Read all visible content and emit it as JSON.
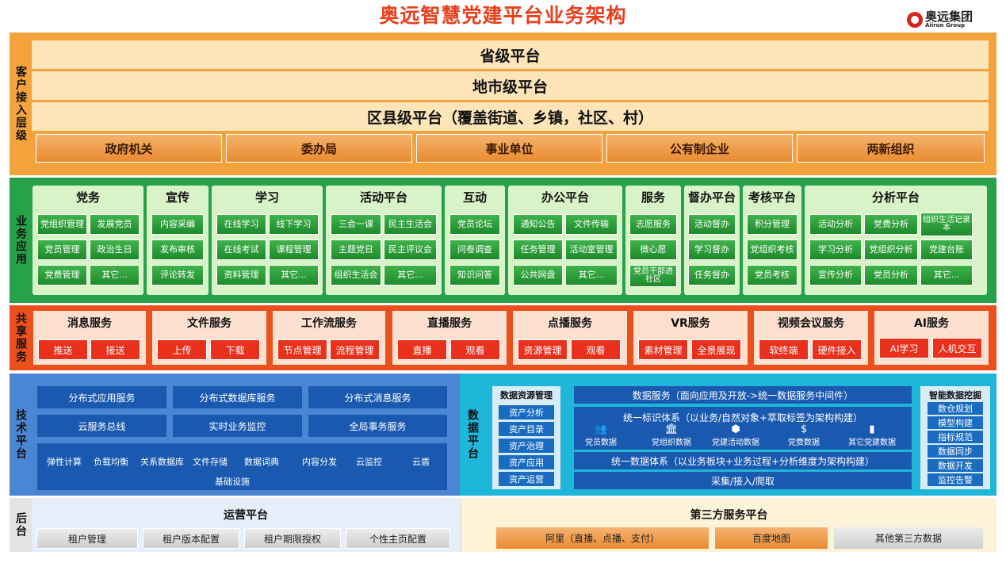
{
  "title": "奥远智慧党建平台业务架构",
  "logo": {
    "cn": "奥远集团",
    "en": "Aiirun Group"
  },
  "layer1": {
    "label": "客户接入层级",
    "platforms": [
      "省级平台",
      "地市级平台",
      "区县级平台（覆盖街道、乡镇，社区、村）"
    ],
    "orgs": [
      "政府机关",
      "委办局",
      "事业单位",
      "公有制企业",
      "两新组织"
    ]
  },
  "layer2": {
    "label": "业务应用",
    "cards": [
      {
        "title": "党务",
        "items": [
          "党组织管理",
          "发展党员",
          "党员管理",
          "政治生日",
          "党费管理",
          "其它..."
        ]
      },
      {
        "title": "宣传",
        "items": [
          "内容采编",
          "发布审核",
          "评论转发"
        ]
      },
      {
        "title": "学习",
        "items": [
          "在线学习",
          "线下学习",
          "在线考试",
          "课程管理",
          "资料管理",
          "其它..."
        ]
      },
      {
        "title": "活动平台",
        "items": [
          "三会一课",
          "民主生活会",
          "主题党日",
          "民主评议会",
          "组织生活会",
          "其它..."
        ]
      },
      {
        "title": "互动",
        "items": [
          "党员论坛",
          "问卷调查",
          "知识问答"
        ]
      },
      {
        "title": "办公平台",
        "items": [
          "通知公告",
          "文件传输",
          "任务管理",
          "活动室管理",
          "公共网盘",
          "其它..."
        ]
      },
      {
        "title": "服务",
        "items": [
          "志愿服务",
          "微心愿",
          "党员干部进社区"
        ]
      },
      {
        "title": "督办平台",
        "items": [
          "活动督办",
          "学习督办",
          "任务督办"
        ]
      },
      {
        "title": "考核平台",
        "items": [
          "积分管理",
          "党组织考核",
          "党员考核"
        ]
      },
      {
        "title": "分析平台",
        "items": [
          "活动分析",
          "党费分析",
          "组织生活记录本",
          "学习分析",
          "党组织分析",
          "党建台账",
          "宣传分析",
          "党员分析",
          "其它..."
        ]
      }
    ]
  },
  "layer3": {
    "label": "共享服务",
    "cards": [
      {
        "title": "消息服务",
        "items": [
          "推送",
          "接送"
        ]
      },
      {
        "title": "文件服务",
        "items": [
          "上传",
          "下载"
        ]
      },
      {
        "title": "工作流服务",
        "items": [
          "节点管理",
          "流程管理"
        ]
      },
      {
        "title": "直播服务",
        "items": [
          "直播",
          "观看"
        ]
      },
      {
        "title": "点播服务",
        "items": [
          "资源管理",
          "观看"
        ]
      },
      {
        "title": "VR服务",
        "items": [
          "素材管理",
          "全景展现"
        ]
      },
      {
        "title": "视频会议服务",
        "items": [
          "软终端",
          "硬件接入"
        ]
      },
      {
        "title": "AI服务",
        "items": [
          "AI学习",
          "人机交互"
        ]
      }
    ]
  },
  "layer4": {
    "label": "技术平台",
    "services": [
      "分布式应用服务",
      "分布式数据库服务",
      "分布式消息服务",
      "云服务总线",
      "实时业务监控",
      "全局事务服务"
    ],
    "infra": [
      "弹性计算",
      "负载均衡",
      "关系数据库",
      "文件存储",
      "数据词典",
      "内容分发",
      "云监控",
      "云盾",
      "基础设施"
    ],
    "data_label": "数据平台",
    "data_resource": {
      "title": "数据资源管理",
      "items": [
        "资产分析",
        "资产目录",
        "资产治理",
        "资产应用",
        "资产运营"
      ]
    },
    "data_service": "数据服务（面向应用及开放->统一数据服务中间件）",
    "unified_id": "统一标识体系（以业务/自然对象+萃取标签为架构构建）",
    "id_items": [
      "党员数据",
      "党组织数据",
      "党建活动数据",
      "党费数据",
      "其它党建数据"
    ],
    "unified_data": "统一数据体系（以业务板块+业务过程+分析维度为架构构建）",
    "collect": "采集/接入/爬取",
    "mining": {
      "title": "智能数据挖掘",
      "items": [
        "数仓规划",
        "模型构建",
        "指标规范",
        "数据同步",
        "数据开发",
        "监控告警"
      ]
    }
  },
  "layer5": {
    "label": "后台",
    "ops": {
      "title": "运营平台",
      "items": [
        "租户管理",
        "租户版本配置",
        "租户期限授权",
        "个性主页配置"
      ]
    },
    "third": {
      "title": "第三方服务平台",
      "items": [
        "阿里（直播、点播、支付）",
        "百度地图",
        "其他第三方数据"
      ]
    }
  }
}
